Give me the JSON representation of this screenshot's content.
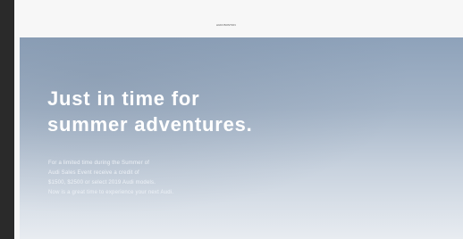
{
  "header": {
    "brand": "AUDI BOSTON"
  },
  "hero": {
    "headline_lines": [
      "Just in time for",
      "summer adventures."
    ],
    "body_lines": [
      "For a limited time during the Summer of",
      "Audi Sales Event receive a credit of",
      "$1500, $2500 or select 2019 Audi models.",
      "Now is a great time to experience your next Audi."
    ]
  }
}
